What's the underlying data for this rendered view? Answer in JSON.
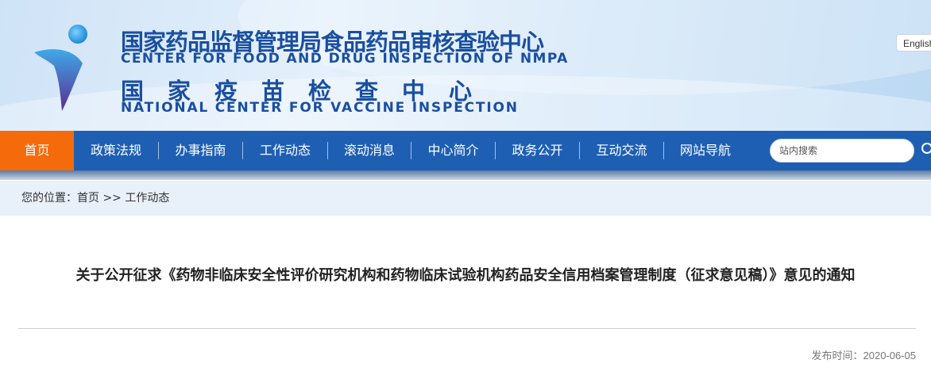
{
  "header": {
    "title_cn_1": "国家药品监督管理局食品药品审核查验中心",
    "title_en_1": "CENTER FOR FOOD AND DRUG INSPECTION OF NMPA",
    "title_cn_2": "国家疫苗检查中心",
    "title_en_2": "NATIONAL CENTER FOR VACCINE INSPECTION",
    "language_button": "English"
  },
  "nav": {
    "items": [
      {
        "label": "首页",
        "active": true
      },
      {
        "label": "政策法规"
      },
      {
        "label": "办事指南"
      },
      {
        "label": "工作动态"
      },
      {
        "label": "滚动消息"
      },
      {
        "label": "中心简介"
      },
      {
        "label": "政务公开"
      },
      {
        "label": "互动交流"
      },
      {
        "label": "网站导航"
      }
    ],
    "search_placeholder": "站内搜索"
  },
  "breadcrumb": {
    "prefix": "您的位置：",
    "home": "首页",
    "separator": " >> ",
    "current": "工作动态"
  },
  "article": {
    "title": "关于公开征求《药物非临床安全性评价研究机构和药物临床试验机构药品安全信用档案管理制度（征求意见稿）》意见的通知",
    "publish_label": "发布时间：",
    "publish_date": "2020-06-05"
  },
  "colors": {
    "brand_blue": "#1e5fb3",
    "active_orange": "#f56a0a",
    "title_blue": "#1a4fa0"
  }
}
